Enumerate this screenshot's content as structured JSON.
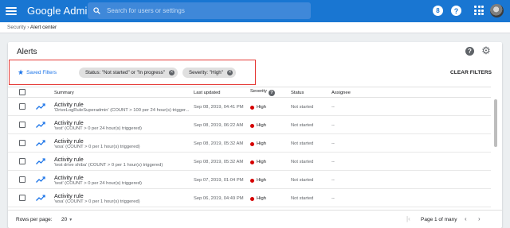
{
  "app": {
    "title": "Google Admin",
    "search_placeholder": "Search for users or settings",
    "notifications_count": "8",
    "help_label": "?",
    "brand_color": "#1976d2"
  },
  "breadcrumb": {
    "items": [
      "Security",
      "Alert center"
    ],
    "separator": "›"
  },
  "card": {
    "title": "Alerts",
    "saved_filters_label": "Saved Filters",
    "filters": [
      "Status: \"Not started\" or \"In progress\"",
      "Severity: \"High\""
    ],
    "clear_filters_label": "CLEAR FILTERS",
    "highlight_color": "#e53935"
  },
  "table": {
    "headers": {
      "summary": "Summary",
      "last_updated": "Last updated",
      "severity": "Severity",
      "status": "Status",
      "assignee": "Assignee"
    },
    "rows": [
      {
        "title": "Activity rule",
        "detail": "'DriveLogRuleSuperadmin' (COUNT > 100 per 24 hour(s) trigger...",
        "updated": "Sep 08, 2019, 04:41 PM",
        "severity": "High",
        "status": "Not started",
        "assignee": "--"
      },
      {
        "title": "Activity rule",
        "detail": "'test' (COUNT > 0 per 24 hour(s) triggered)",
        "updated": "Sep 08, 2019, 06:22 AM",
        "severity": "High",
        "status": "Not started",
        "assignee": "--"
      },
      {
        "title": "Activity rule",
        "detail": "'wsa' (COUNT > 0 per 1 hour(s) triggered)",
        "updated": "Sep 08, 2019, 05:32 AM",
        "severity": "High",
        "status": "Not started",
        "assignee": "--"
      },
      {
        "title": "Activity rule",
        "detail": "'test drive shiba' (COUNT > 0 per 1 hour(s) triggered)",
        "updated": "Sep 08, 2019, 05:32 AM",
        "severity": "High",
        "status": "Not started",
        "assignee": "--"
      },
      {
        "title": "Activity rule",
        "detail": "'test' (COUNT > 0 per 24 hour(s) triggered)",
        "updated": "Sep 07, 2019, 01:04 PM",
        "severity": "High",
        "status": "Not started",
        "assignee": "--"
      },
      {
        "title": "Activity rule",
        "detail": "'wsa' (COUNT > 0 per 1 hour(s) triggered)",
        "updated": "Sep 06, 2019, 04:49 PM",
        "severity": "High",
        "status": "Not started",
        "assignee": "--"
      }
    ],
    "severity_color": "#d50000"
  },
  "footer": {
    "rows_per_page_label": "Rows per page:",
    "rows_per_page_value": "20",
    "page_info": "Page 1 of many"
  }
}
